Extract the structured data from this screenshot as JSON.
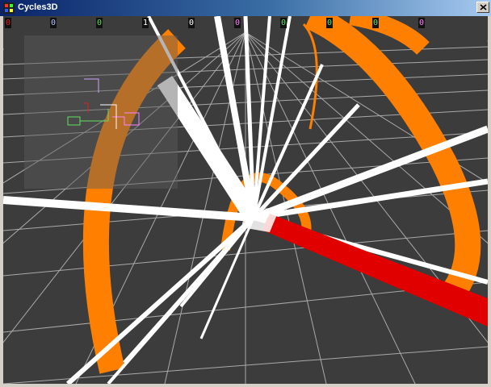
{
  "window": {
    "title": "Cycles3D",
    "close_icon": "close-icon",
    "app_icon": "cycles-app-icon"
  },
  "scoreboard": [
    {
      "value": "0",
      "color": "#e02020"
    },
    {
      "value": "0",
      "color": "#b0c4ff"
    },
    {
      "value": "0",
      "color": "#60e060"
    },
    {
      "value": "1",
      "color": "#ffffff"
    },
    {
      "value": "0",
      "color": "#ffffff"
    },
    {
      "value": "0",
      "color": "#ff80ff"
    },
    {
      "value": "0",
      "color": "#60e060"
    },
    {
      "value": "0",
      "color": "#60e060"
    },
    {
      "value": "0",
      "color": "#60e060"
    },
    {
      "value": "0",
      "color": "#ff80ff"
    }
  ],
  "colors": {
    "floor": "#3c3c3c",
    "grid": "#c8c8c8",
    "orange_trail": "#ff8000",
    "white_trail": "#ffffff",
    "red_trail": "#e00000"
  }
}
